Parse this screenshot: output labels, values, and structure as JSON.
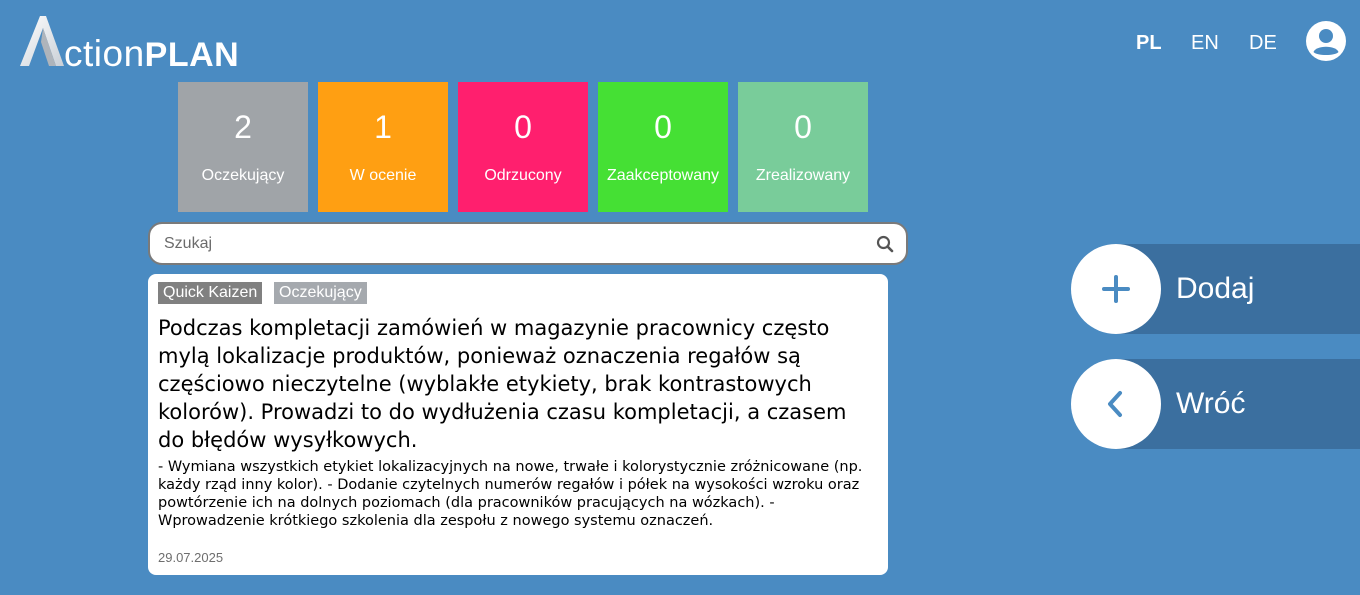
{
  "header": {
    "logo": {
      "initial": "A",
      "text_light": "ction",
      "text_bold": "PLAN"
    },
    "languages": [
      {
        "label": "PL",
        "active": true
      },
      {
        "label": "EN",
        "active": false
      },
      {
        "label": "DE",
        "active": false
      }
    ],
    "user_icon": "account-circle-icon"
  },
  "status_tiles": [
    {
      "count": "2",
      "label": "Oczekujący",
      "color": "#a0a4a8"
    },
    {
      "count": "1",
      "label": "W ocenie",
      "color": "#ff9f12"
    },
    {
      "count": "0",
      "label": "Odrzucony",
      "color": "#ff1f6e"
    },
    {
      "count": "0",
      "label": "Zaakceptowany",
      "color": "#45e034"
    },
    {
      "count": "0",
      "label": "Zrealizowany",
      "color": "#79cc9a"
    }
  ],
  "search": {
    "placeholder": "Szukaj",
    "value": "",
    "icon": "search-icon"
  },
  "cards": [
    {
      "tags": [
        "Quick Kaizen",
        "Oczekujący"
      ],
      "title": "Podczas kompletacji zamówień w magazynie pracownicy często mylą lokalizacje produktów, ponieważ oznaczenia regałów są częściowo nieczytelne (wyblakłe etykiety, brak kontrastowych kolorów). Prowadzi to do wydłużenia czasu kompletacji, a czasem do błędów wysyłkowych.",
      "description": "- Wymiana wszystkich etykiet lokalizacyjnych na nowe, trwałe i kolorystycznie zróżnicowane (np. każdy rząd inny kolor). - Dodanie czytelnych numerów regałów i półek na wysokości wzroku oraz powtórzenie ich na dolnych poziomach (dla pracowników pracujących na wózkach). - Wprowadzenie krótkiego szkolenia dla zespołu z nowego systemu oznaczeń.",
      "date": "29.07.2025"
    }
  ],
  "actions": {
    "add": {
      "label": "Dodaj",
      "icon": "plus-icon"
    },
    "back": {
      "label": "Wróć",
      "icon": "chevron-left-icon"
    }
  },
  "colors": {
    "background": "#4a8bc2",
    "action_band": "#3b6f9f",
    "action_icon": "#4a8bc2"
  }
}
